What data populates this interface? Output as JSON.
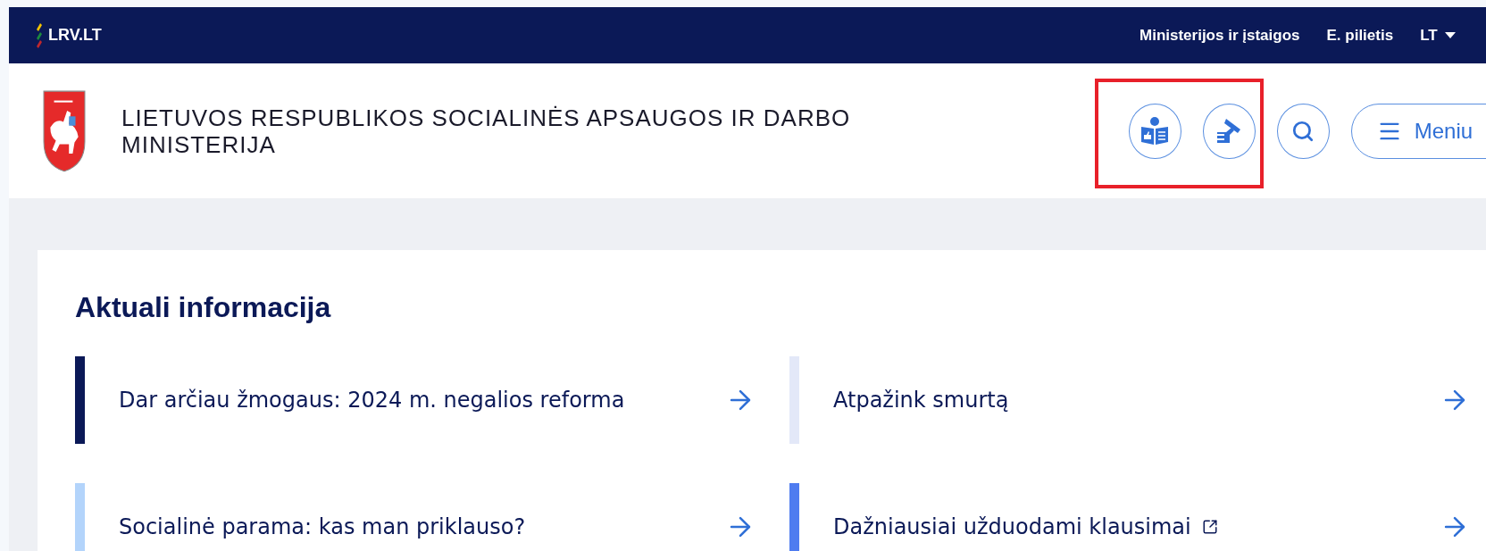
{
  "top_bar": {
    "logo": "LRV.LT",
    "links": [
      "Ministerijos ir įstaigos",
      "E. pilietis"
    ],
    "language": "LT"
  },
  "header": {
    "title": "LIETUVOS RESPUBLIKOS SOCIALINĖS APSAUGOS IR DARBO MINISTERIJA",
    "menu_label": "Meniu",
    "highlighted": true
  },
  "section": {
    "heading": "Aktuali informacija",
    "items": [
      {
        "label": "Dar arčiau žmogaus: 2024 m. negalios reforma",
        "color": "#0b1957",
        "external": false
      },
      {
        "label": "Atpažink smurtą",
        "color": "#e3e8f8",
        "external": false
      },
      {
        "label": "Socialinė parama: kas man priklauso?",
        "color": "#b3d4fb",
        "external": false
      },
      {
        "label": "Dažniausiai užduodami klausimai",
        "color": "#4f7cf0",
        "external": true
      }
    ]
  }
}
